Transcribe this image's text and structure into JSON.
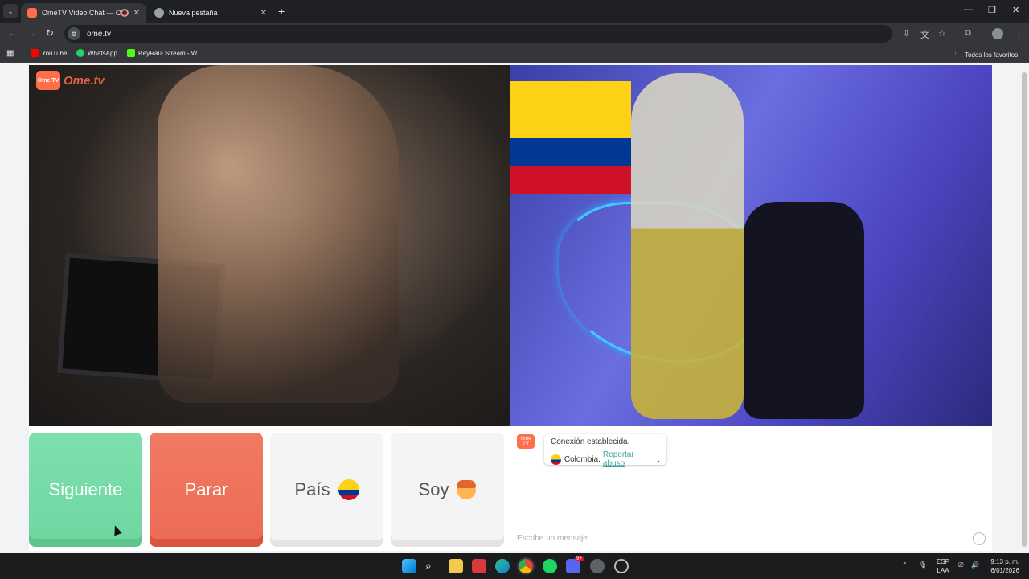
{
  "browser": {
    "tabs": [
      {
        "title": "OmeTV Video Chat — Ome",
        "active": true
      },
      {
        "title": "Nueva pestaña",
        "active": false
      }
    ],
    "url": "ome.tv",
    "bookmarks": [
      {
        "label": "YouTube",
        "color": "#ff0000"
      },
      {
        "label": "WhatsApp",
        "color": "#25d366"
      },
      {
        "label": "ReyRaul Stream - W...",
        "color": "#53fc18"
      }
    ],
    "all_bookmarks_label": "Todos los favoritos"
  },
  "page": {
    "logo_box": "Ome TV",
    "logo_text": "Ome.tv",
    "buttons": {
      "next": "Siguiente",
      "stop": "Parar",
      "country": "País",
      "me": "Soy"
    },
    "chat": {
      "logo": "Ome TV",
      "connection_message": "Conexión establecida.",
      "country": "Colombia.",
      "report_link": "Reportar abuso",
      "report_suffix": ".",
      "input_placeholder": "Escribe un mensaje"
    }
  },
  "taskbar": {
    "lang_line1": "ESP",
    "lang_line2": "LAA",
    "time": "9:13 p. m.",
    "date": "6/01/2026",
    "discord_badge": "9+"
  },
  "colors": {
    "next_button": "#6fd6a0",
    "stop_button": "#ec6b55",
    "brand": "#ff6e4a",
    "link": "#3aa5a0"
  }
}
